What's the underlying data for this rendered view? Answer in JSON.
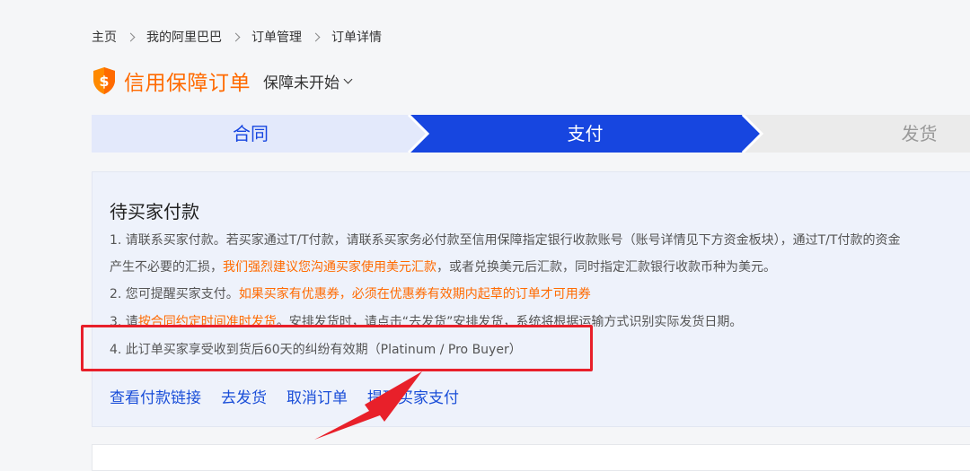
{
  "breadcrumb": {
    "items": [
      "主页",
      "我的阿里巴巴",
      "订单管理",
      "订单详情"
    ]
  },
  "header": {
    "shield_glyph": "$",
    "title": "信用保障订单",
    "status": "保障未开始"
  },
  "steps": [
    {
      "label": "合同",
      "state": "done"
    },
    {
      "label": "支付",
      "state": "active"
    },
    {
      "label": "发货",
      "state": "pending"
    }
  ],
  "card": {
    "title": "待买家付款",
    "line1": "1. 请联系买家付款。若买家通过T/T付款，请联系买家务必付款至信用保障指定银行收款账号（账号详情见下方资金板块），通过T/T付款的资金",
    "line2_a": "产生不必要的汇损，",
    "line2_b": "我们强烈建议您沟通买家使用美元汇款",
    "line2_c": "，或者兑换美元后汇款，同时指定汇款银行收款币种为美元。",
    "line3_a": "2. 您可提醒买家支付。",
    "line3_b": "如果买家有优惠券，必须在优惠券有效期内起草的订单才可用券",
    "line4_a": "3. 请",
    "line4_b": "按合同约定时间准时发货",
    "line4_c": "。安排发货时，请点击“去发货”安排发货，系统将根据运输方式识别实际发货日期。",
    "line5": "4. 此订单买家享受收到货后60天的纠纷有效期（Platinum / Pro Buyer）"
  },
  "actions": {
    "view_payment_link": "查看付款链接",
    "ship": "去发货",
    "cancel_order": "取消订单",
    "remind_buyer": "提醒买家支付"
  },
  "colors": {
    "brand_orange": "#ff6a00",
    "step_done_bg": "#e3e9fb",
    "step_active_bg": "#1746e0",
    "step_pending_bg": "#ebebeb",
    "link_blue": "#1a4ed8",
    "annotation_red": "#e8202a"
  },
  "icons": {
    "shield": "shield-dollar-icon",
    "dropdown": "chevron-down-icon",
    "separator": "chevron-right-icon"
  }
}
